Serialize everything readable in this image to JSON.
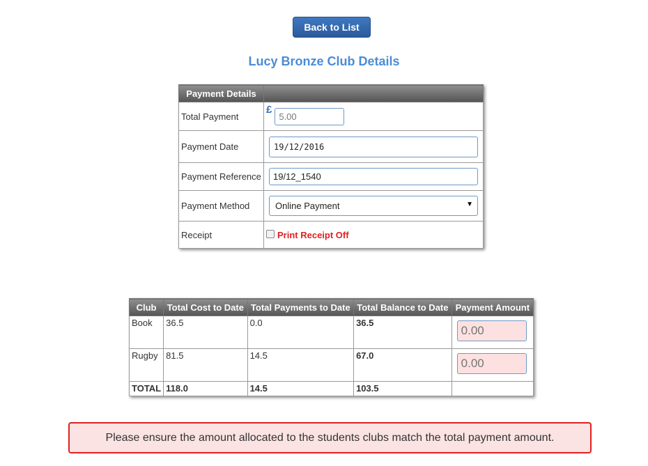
{
  "back_button_label": "Back to List",
  "page_title": "Lucy Bronze Club Details",
  "payment_details": {
    "header": "Payment Details",
    "total_payment_label": "Total Payment",
    "currency_symbol": "£",
    "total_payment_value": "5.00",
    "payment_date_label": "Payment Date",
    "payment_date_value": "19/12/2016",
    "payment_reference_label": "Payment Reference",
    "payment_reference_value": "19/12_1540",
    "payment_method_label": "Payment Method",
    "payment_method_value": "Online Payment",
    "receipt_label": "Receipt",
    "receipt_checkbox_label": "Print Receipt Off"
  },
  "clubs": {
    "headers": [
      "Club",
      "Total Cost to Date",
      "Total Payments to Date",
      "Total Balance to Date",
      "Payment Amount"
    ],
    "rows": [
      {
        "club": "Book",
        "cost": "36.5",
        "payments": "0.0",
        "balance": "36.5",
        "amount_placeholder": "0.00"
      },
      {
        "club": "Rugby",
        "cost": "81.5",
        "payments": "14.5",
        "balance": "67.0",
        "amount_placeholder": "0.00"
      }
    ],
    "total": {
      "label": "TOTAL",
      "cost": "118.0",
      "payments": "14.5",
      "balance": "103.5"
    }
  },
  "error_message": "Please ensure the amount allocated to the students clubs match the total payment amount.",
  "colors": {
    "accent": "#4a8cd6",
    "error": "#e02020",
    "button": "#2a5a9c"
  }
}
